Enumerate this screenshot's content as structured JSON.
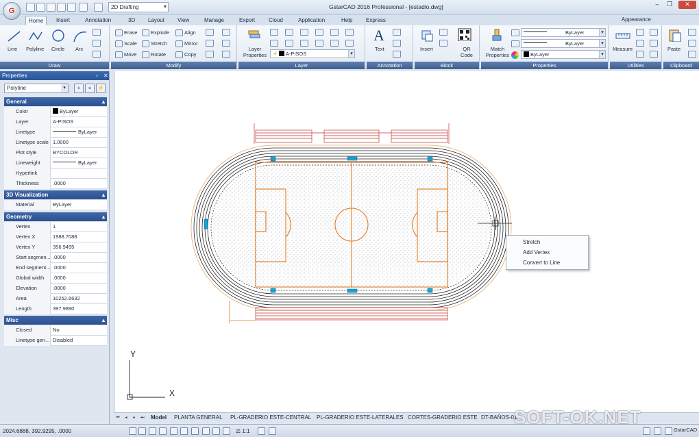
{
  "titlebar": {
    "workspace": "2D Drafting",
    "title": "GstarCAD 2016 Professional - [estadio.dwg]",
    "app_letter": "G"
  },
  "tabs": [
    "Home",
    "Insert",
    "Annotation",
    "3D",
    "Layout",
    "View",
    "Manage",
    "Export",
    "Cloud",
    "Application",
    "Help",
    "Express"
  ],
  "appearance": "Appearance",
  "ribbon": {
    "draw": {
      "title": "Draw",
      "line": "Line",
      "polyline": "Polyline",
      "circle": "Circle",
      "arc": "Arc"
    },
    "modify": {
      "title": "Modify",
      "erase": "Erase",
      "explode": "Explode",
      "align": "Align",
      "scale": "Scale",
      "stretch": "Stretch",
      "mirror": "Mirror",
      "move": "Move",
      "rotate": "Rotate",
      "copy": "Copy"
    },
    "layer": {
      "title": "Layer",
      "layer_properties": "Layer Properties",
      "current_layer": "A-PISOS"
    },
    "annotation": {
      "title": "Annotation",
      "text": "Text"
    },
    "block": {
      "title": "Block",
      "insert": "Insert",
      "qr_code": "QR Code"
    },
    "properties": {
      "title": "Properties",
      "match": "Match Properties",
      "linetype": "ByLayer",
      "lineweight": "ByLayer",
      "color": "ByLayer"
    },
    "utilities": {
      "title": "Utilities",
      "measure": "Measure"
    },
    "clipboard": {
      "title": "Clipboard",
      "paste": "Paste"
    }
  },
  "properties_panel": {
    "title": "Properties",
    "object": "Polyline",
    "sections": {
      "general": "General",
      "viz": "3D Visualization",
      "geometry": "Geometry",
      "misc": "Misc"
    },
    "general": [
      {
        "k": "Color",
        "v": "ByLayer"
      },
      {
        "k": "Layer",
        "v": "A-PISOS"
      },
      {
        "k": "Linetype",
        "v": "ByLayer"
      },
      {
        "k": "Linetype scale",
        "v": "1.0000"
      },
      {
        "k": "Plot style",
        "v": "BYCOLOR"
      },
      {
        "k": "Lineweight",
        "v": "ByLayer"
      },
      {
        "k": "Hyperlink",
        "v": ""
      },
      {
        "k": "Thickness",
        "v": ".0000"
      }
    ],
    "viz": [
      {
        "k": "Material",
        "v": "ByLayer"
      }
    ],
    "geometry": [
      {
        "k": "Vertex",
        "v": "1"
      },
      {
        "k": "Vertex X",
        "v": "1988.7088"
      },
      {
        "k": "Vertex Y",
        "v": "356.9495"
      },
      {
        "k": "Start segmen...",
        "v": ".0000"
      },
      {
        "k": "End segment...",
        "v": ".0000"
      },
      {
        "k": "Global width",
        "v": ".0000"
      },
      {
        "k": "Elevation",
        "v": ".0000"
      },
      {
        "k": "Area",
        "v": "10252.6632"
      },
      {
        "k": "Length",
        "v": "397.9890"
      }
    ],
    "misc": [
      {
        "k": "Closed",
        "v": "No"
      },
      {
        "k": "Linetype gen...",
        "v": "Disabled"
      }
    ]
  },
  "context_menu": [
    "Stretch",
    "Add Vertex",
    "Convert to Line"
  ],
  "ucs": {
    "x": "X",
    "y": "Y"
  },
  "layout_tabs": [
    "Model",
    "PLANTA GENERAL",
    "PL-GRADERIO ESTE-CENTRAL",
    "PL-GRADERIO ESTE-LATERALES",
    "CORTES-GRADERIO ESTE",
    "DT-BAÑOS-01"
  ],
  "status": {
    "coords": "2024.6888, 392.9295, .0000",
    "scale": "1:1",
    "app": "GstarCAD"
  },
  "watermark": "SOFT-OK.NET"
}
